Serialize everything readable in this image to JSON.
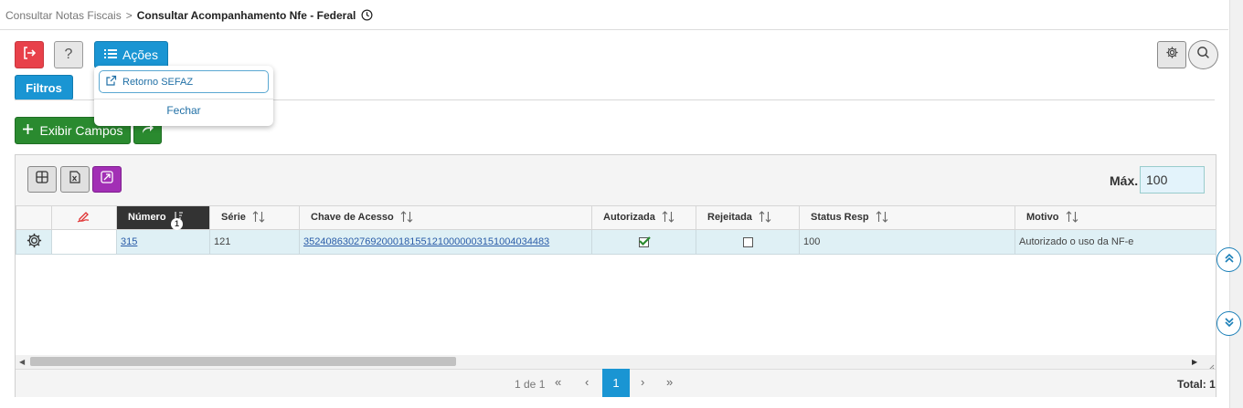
{
  "breadcrumb": {
    "parent": "Consultar Notas Fiscais",
    "separator": ">",
    "current": "Consultar Acompanhamento Nfe - Federal"
  },
  "toolbar": {
    "help_label": "?",
    "acoes_label": "Ações",
    "filtros_label": "Filtros",
    "exibir_campos_label": "Exibir Campos"
  },
  "acoes_menu": {
    "items": [
      {
        "label": "Retorno SEFAZ"
      }
    ],
    "close_label": "Fechar"
  },
  "grid": {
    "max_label": "Máx.",
    "max_value": "100",
    "columns": [
      "",
      "",
      "Número",
      "Série",
      "Chave de Acesso",
      "Autorizada",
      "Rejeitada",
      "Status Resp",
      "Motivo"
    ],
    "sort_order_badge": "1",
    "rows": [
      {
        "numero": "315",
        "serie": "121",
        "chave": "35240863027692000181551210000003151004034483",
        "autorizada": true,
        "rejeitada": false,
        "status_resp": "100",
        "motivo": "Autorizado o uso da NF-e"
      }
    ]
  },
  "pagination": {
    "info": "1 de 1",
    "first": "«",
    "prev": "‹",
    "current": "1",
    "next": "›",
    "last": "»",
    "total": "Total: 1"
  },
  "colors": {
    "primary": "#1a95d3",
    "danger": "#e8414a",
    "success": "#2a8a2f",
    "purple": "#a22fb5",
    "header_dark": "#333333",
    "row_bg": "#dff0f5"
  }
}
